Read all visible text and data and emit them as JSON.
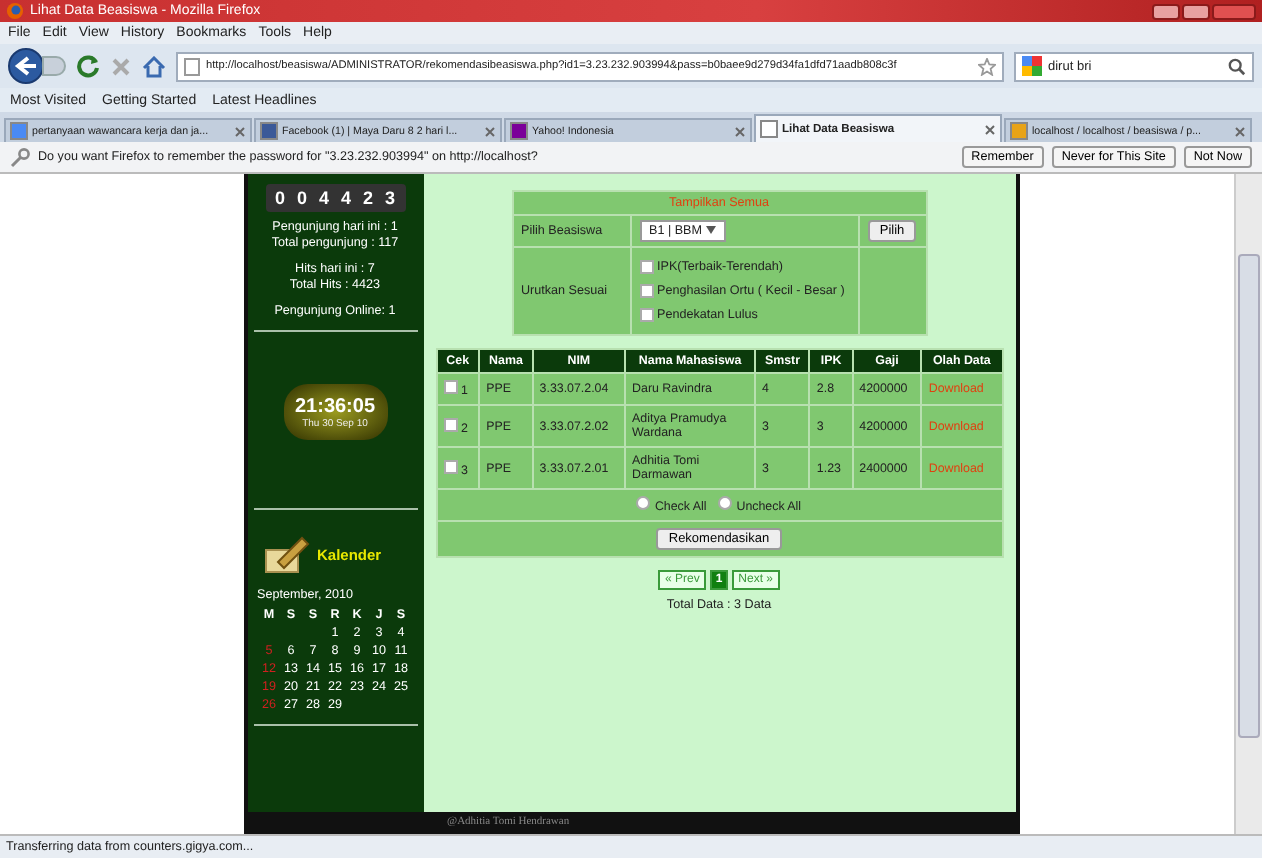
{
  "window": {
    "title": "Lihat Data Beasiswa - Mozilla Firefox"
  },
  "menu": [
    "File",
    "Edit",
    "View",
    "History",
    "Bookmarks",
    "Tools",
    "Help"
  ],
  "address": {
    "value": "http://localhost/beasiswa/ADMINISTRATOR/rekomendasibeasiswa.php?id1=3.23.232.903994&pass=b0baee9d279d34fa1dfd71aadb808c3f"
  },
  "search": {
    "value": "dirut bri"
  },
  "bookmarks": [
    "Most Visited",
    "Getting Started",
    "Latest Headlines"
  ],
  "tabs": [
    {
      "label": "pertanyaan wawancara kerja dan ja...",
      "selected": false,
      "kind": "google"
    },
    {
      "label": "Facebook (1) | Maya Daru 8 2 hari l...",
      "selected": false,
      "kind": "facebook"
    },
    {
      "label": "Yahoo! Indonesia",
      "selected": false,
      "kind": "yahoo"
    },
    {
      "label": "Lihat Data Beasiswa",
      "selected": true,
      "kind": "page"
    },
    {
      "label": "localhost / localhost / beasiswa / p...",
      "selected": false,
      "kind": "pma"
    }
  ],
  "password_bar": {
    "message": "Do you want Firefox to remember the password for \"3.23.232.903994\" on http://localhost?",
    "buttons": [
      "Remember",
      "Never for This Site",
      "Not Now"
    ]
  },
  "sidebar": {
    "counter": [
      "0",
      "0",
      "4",
      "4",
      "2",
      "3"
    ],
    "stats": [
      "Pengunjung hari ini : 1",
      "Total pengunjung : 117"
    ],
    "hits": [
      "Hits hari ini : 7",
      "Total Hits : 4423"
    ],
    "online": "Pengunjung Online: 1",
    "clock": {
      "time": "21:36:05",
      "date": "Thu 30 Sep 10"
    },
    "calendar": {
      "title": "Kalender",
      "month": "September, 2010",
      "weekdays": [
        "M",
        "S",
        "S",
        "R",
        "K",
        "J",
        "S"
      ],
      "weeks": [
        {
          "kind": "first",
          "days": [
            "1",
            "2",
            "3",
            "4"
          ]
        },
        {
          "kind": "week",
          "days": [
            "5",
            "6",
            "7",
            "8",
            "9",
            "10",
            "11"
          ]
        },
        {
          "kind": "week",
          "days": [
            "12",
            "13",
            "14",
            "15",
            "16",
            "17",
            "18"
          ]
        },
        {
          "kind": "week",
          "days": [
            "19",
            "20",
            "21",
            "22",
            "23",
            "24",
            "25"
          ]
        },
        {
          "kind": "week",
          "days": [
            "26",
            "27",
            "28",
            "29"
          ]
        }
      ]
    }
  },
  "filter": {
    "header": "Tampilkan Semua",
    "scholarship_label": "Pilih Beasiswa",
    "scholarship_value": "B1 | BBM",
    "submit": "Pilih",
    "sort_label": "Urutkan Sesuai",
    "sort_options": [
      {
        "label": "IPK(Terbaik-Terendah)",
        "checked": false
      },
      {
        "label": "Penghasilan Ortu ( Kecil - Besar )",
        "checked": false
      },
      {
        "label": "Pendekatan Lulus",
        "checked": false
      }
    ]
  },
  "table": {
    "columns": [
      "Cek",
      "Nama",
      "NIM",
      "Nama Mahasiswa",
      "Smstr",
      "IPK",
      "Gaji",
      "Olah Data"
    ],
    "rows": [
      {
        "checked": false,
        "cells": [
          "1",
          "PPE",
          "3.33.07.2.04",
          "Daru Ravindra",
          "4",
          "2.8",
          "4200000",
          "Download"
        ]
      },
      {
        "checked": false,
        "cells": [
          "2",
          "PPE",
          "3.33.07.2.02",
          "Aditya Pramudya Wardana",
          "3",
          "3",
          "4200000",
          "Download"
        ]
      },
      {
        "checked": false,
        "cells": [
          "3",
          "PPE",
          "3.33.07.2.01",
          "Adhitia Tomi Darmawan",
          "3",
          "1.23",
          "2400000",
          "Download"
        ]
      }
    ],
    "check_all": {
      "label": "Check All",
      "checked": false
    },
    "uncheck_all": {
      "label": "Uncheck All",
      "checked": false
    },
    "submit": "Rekomendasikan"
  },
  "pagination": [
    {
      "label": "« Prev",
      "selected": false
    },
    {
      "label": "1",
      "selected": true
    },
    {
      "label": "Next »",
      "selected": false
    }
  ],
  "total": "Total Data : 3 Data",
  "footer": "@Adhitia Tomi Hendrawan",
  "status_bar": "Transferring data from counters.gigya.com..."
}
